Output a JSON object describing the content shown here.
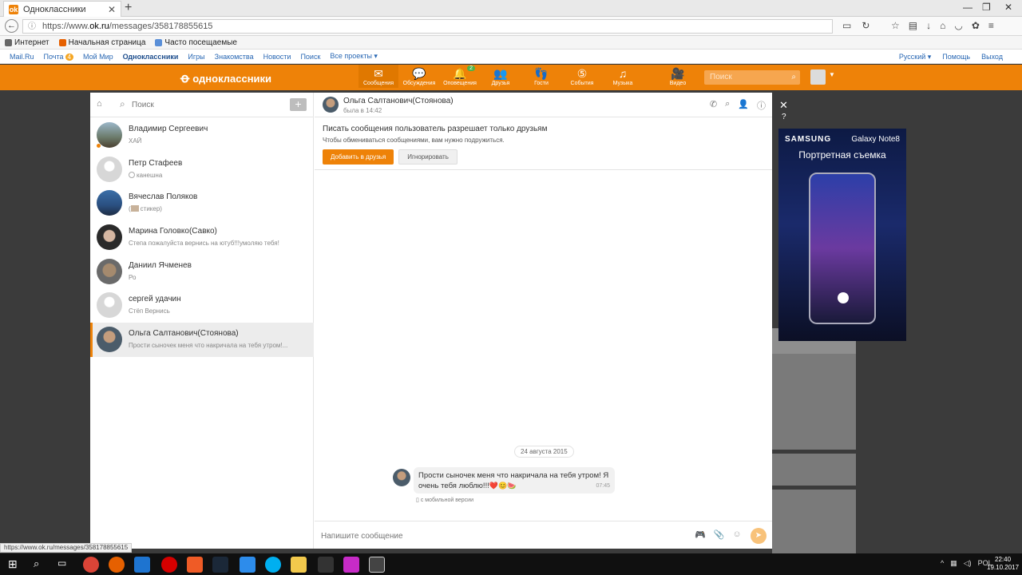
{
  "browser": {
    "tab_title": "Одноклассники",
    "tab_icon": "ok-favicon",
    "url_prefix": "https://www.",
    "url_host": "ok.ru",
    "url_path": "/messages/358178855615",
    "bookmarks": [
      "Интернет",
      "Начальная страница",
      "Часто посещаемые"
    ]
  },
  "portal": {
    "links": [
      "Mail.Ru",
      "Почта",
      "Мой Мир",
      "Одноклассники",
      "Игры",
      "Знакомства",
      "Новости",
      "Поиск",
      "Все проекты ▾"
    ],
    "mail_badge": "4",
    "language": "Русский ▾",
    "help": "Помощь",
    "logout": "Выход"
  },
  "ok_header": {
    "logo_text": "одноклассники",
    "accent_color": "#ee8208",
    "nav": [
      {
        "label": "Сообщения",
        "icon": "envelope-icon"
      },
      {
        "label": "Обсуждения",
        "icon": "speech-bubbles-icon"
      },
      {
        "label": "Оповещения",
        "icon": "bell-icon",
        "badge": "2"
      },
      {
        "label": "Друзья",
        "icon": "friends-icon"
      },
      {
        "label": "Гости",
        "icon": "footprints-icon"
      },
      {
        "label": "События",
        "icon": "events-icon"
      },
      {
        "label": "Музыка",
        "icon": "music-note-icon"
      },
      {
        "label": "Видео",
        "icon": "video-camera-icon"
      }
    ],
    "search_placeholder": "Поиск"
  },
  "messenger": {
    "search_placeholder": "Поиск",
    "chats": [
      {
        "name": "Владимир Сергеевич",
        "preview": "ХАЙ",
        "online": true
      },
      {
        "name": "Петр Стафеев",
        "preview": "канешна"
      },
      {
        "name": "Вячеслав Поляков",
        "preview": "стикер)"
      },
      {
        "name": "Марина Головко(Савко)",
        "preview": "Степа пожалуйста вернись на ютуб!!!умоляю тебя!"
      },
      {
        "name": "Даниил Ячменев",
        "preview": "Ро"
      },
      {
        "name": "сергей удачин",
        "preview": "Стёп Вернись"
      },
      {
        "name": "Ольга Салтанович(Стоянова)",
        "preview": "Прости сыночек меня что накричала на тебя утром!...",
        "active": true
      }
    ],
    "conversation": {
      "peer_name": "Ольга Салтанович(Стоянова)",
      "peer_status": "была в 14:42",
      "notice_title": "Писать сообщения пользователь разрешает только друзьям",
      "notice_sub": "Чтобы обмениваться сообщениями, вам нужно подружиться.",
      "add_friend_btn": "Добавить в друзья",
      "ignore_btn": "Игнорировать",
      "date": "24 августа 2015",
      "message_line1": "Прости сыночек меня что накричала на тебя утром! Я",
      "message_line2": "очень тебя люблю!!!",
      "message_emoji": "❤️😊🍉",
      "message_time": "07:45",
      "mobile_note": "с мобильной версии",
      "composer_placeholder": "Напишите сообщение"
    }
  },
  "ad": {
    "brand": "SAMSUNG",
    "model": "Galaxy Note8",
    "tagline": "Портретная съемка"
  },
  "status_url": "https://www.ok.ru/messages/358178855615",
  "taskbar": {
    "lang": "POL",
    "time": "22:40",
    "date": "19.10.2017"
  }
}
